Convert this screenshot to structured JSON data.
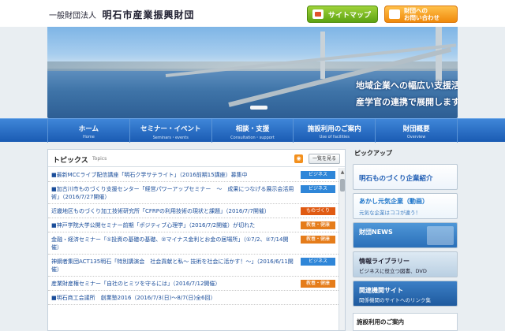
{
  "header": {
    "org_type": "一般財団法人",
    "org_name": "明石市産業振興財団",
    "sitemap_label": "サイトマップ",
    "contact_line1": "財団への",
    "contact_line2": "お問い合わせ"
  },
  "hero": {
    "caption_line1": "地域企業への幅広い支援活動を",
    "caption_line2": "産学官の連携で展開します"
  },
  "nav": [
    {
      "jp": "ホーム",
      "en": "Home"
    },
    {
      "jp": "セミナー・イベント",
      "en": "Seminars・events"
    },
    {
      "jp": "相談・支援",
      "en": "Consultation・support"
    },
    {
      "jp": "施設利用のご案内",
      "en": "Use of facilities"
    },
    {
      "jp": "財団概要",
      "en": "Overview"
    }
  ],
  "topics": {
    "title": "トピックス",
    "subtitle": "Topics",
    "more_label": "一覧を見る",
    "items": [
      {
        "text": "■最新MCCライブ配信講座「明石ク学サテライト」（2016前期15講座）募集中",
        "tag": "ビジネス",
        "tag_type": "biz"
      },
      {
        "text": "■加古川市ものづくり支援センター「経営パワーアップセミナー　～　成果につなげる展示会活用術」（2016/7/27開催）",
        "tag": "ビジネス",
        "tag_type": "biz"
      },
      {
        "text": "近畿地区ものづくり加工技術研究所「CFRPの利用技術の現状と課題」（2016/7/7開催）",
        "tag": "ものづくり",
        "tag_type": "mono"
      },
      {
        "text": "■神戸学院大学公開セミナー前期「ポジティブ心理学」（2016/7/2開催）が切れた",
        "tag": "教養・健康",
        "tag_type": "edu"
      },
      {
        "text": "金融・経済セミナー「①投資の基礎の基礎、②マイナス金利とお金の居場所」（①7/2、②7/14開催）",
        "tag": "教養・健康",
        "tag_type": "edu"
      },
      {
        "text": "神鋼者集団ACT135明石「特別講演会　社会貢献と私～ 技術を社会に活かす！～」（2016/6/11開催）",
        "tag": "ビジネス",
        "tag_type": "biz"
      },
      {
        "text": "産業財産権セミナー「自社のヒミツを守るには」（2016/7/12開催）",
        "tag": "教養・健康",
        "tag_type": "edu"
      },
      {
        "text": "■明石商工会議所　創業塾2016（2016/7/3(日)～8/7(日)全6回）",
        "tag": "",
        "tag_type": ""
      }
    ]
  },
  "pickup": {
    "title": "ピックアップ",
    "banners": [
      {
        "line1": "明石ものづくり企業紹介",
        "line2": ""
      },
      {
        "line1": "あかし元気企業（動画）",
        "line2": "元気な企業はココが違う！"
      },
      {
        "line1": "財団NEWS",
        "line2": ""
      },
      {
        "line1": "情報ライブラリー",
        "line2": "ビジネスに役立つ図書、DVD"
      },
      {
        "line1": "関連機関サイト",
        "line2": "関係機関のサイトへのリンク集"
      }
    ],
    "footer_title": "施設利用のご案内"
  }
}
